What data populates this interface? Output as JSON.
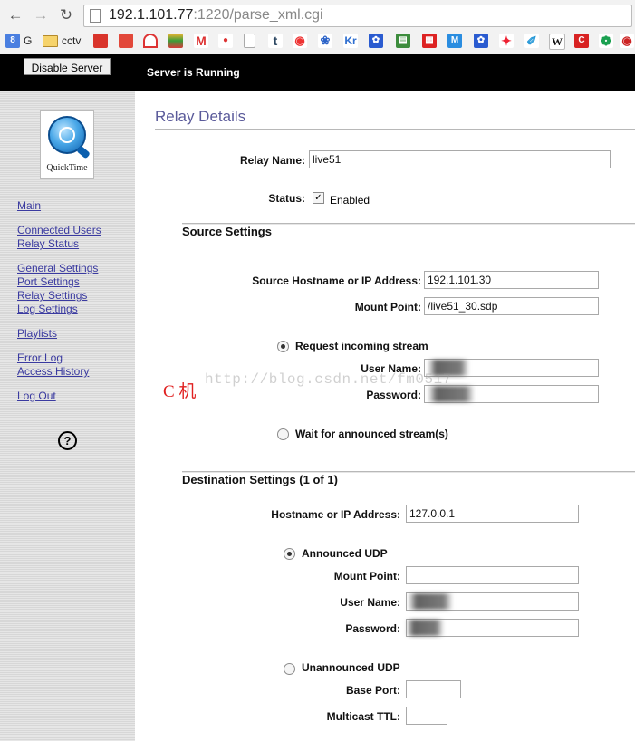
{
  "browser": {
    "url_host": "192.1.101.77",
    "url_rest": ":1220/parse_xml.cgi",
    "bookmarks": {
      "g_label": "G",
      "cctv_label": "cctv",
      "tumblr": "t",
      "kr": "Kr",
      "wiki": "W"
    }
  },
  "topbar": {
    "disable_button": "Disable Server",
    "status": "Server is Running"
  },
  "sidebar": {
    "logo_label": "QuickTime",
    "links": {
      "main": "Main",
      "connected_users": "Connected Users",
      "relay_status": "Relay Status",
      "general_settings": "General Settings",
      "port_settings": "Port Settings",
      "relay_settings": "Relay Settings",
      "log_settings": "Log Settings",
      "playlists": "Playlists",
      "error_log": "Error Log",
      "access_history": "Access History",
      "log_out": "Log Out"
    },
    "help": "?"
  },
  "main": {
    "title": "Relay Details",
    "relay_name_label": "Relay Name:",
    "relay_name_value": "live51",
    "status_label": "Status:",
    "status_enabled": "Enabled",
    "source": {
      "title": "Source Settings",
      "hostname_label": "Source Hostname or IP Address:",
      "hostname_value": "192.1.101.30",
      "mount_label": "Mount Point:",
      "mount_value": "/live51_30.sdp",
      "request_label": "Request incoming stream",
      "user_label": "User Name:",
      "password_label": "Password:",
      "wait_label": "Wait for announced stream(s)"
    },
    "destination": {
      "title": "Destination Settings (1 of 1)",
      "hostname_label": "Hostname or IP Address:",
      "hostname_value": "127.0.0.1",
      "announced_label": "Announced UDP",
      "mount_label": "Mount Point:",
      "user_label": "User Name:",
      "password_label": "Password:",
      "unannounced_label": "Unannounced UDP",
      "base_port_label": "Base Port:",
      "ttl_label": "Multicast TTL:"
    }
  },
  "overlay": {
    "watermark": "http://blog.csdn.net/fm0517",
    "annotation": "C 机"
  }
}
